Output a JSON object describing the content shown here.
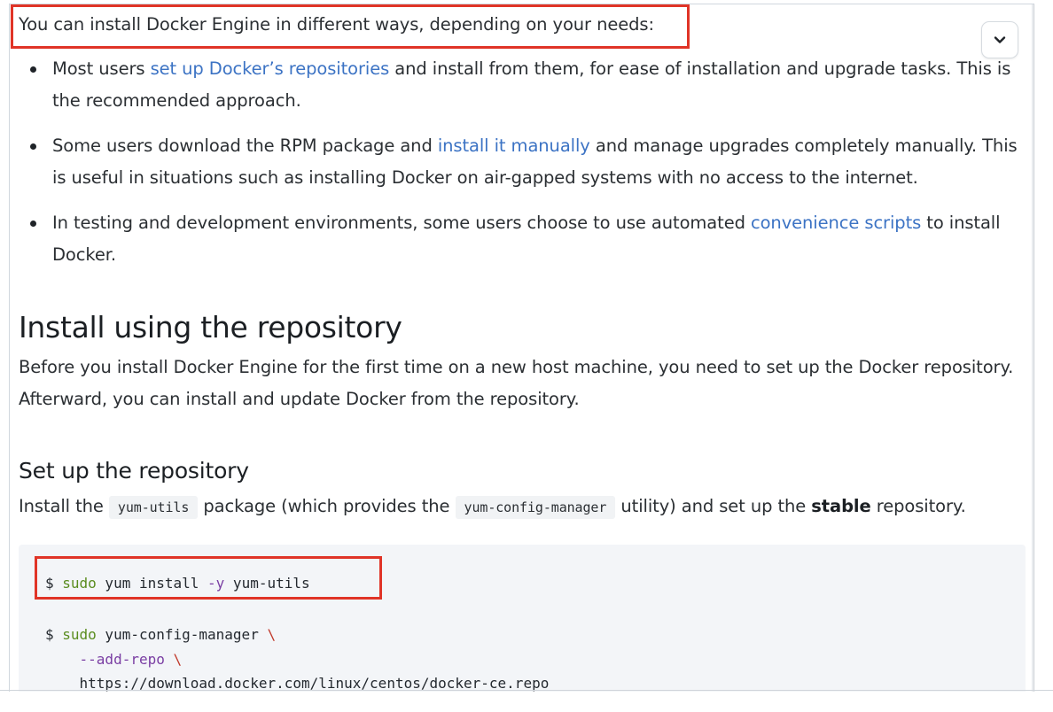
{
  "intro": {
    "text": "You can install Docker Engine in different ways, depending on your needs:"
  },
  "bullets": [
    {
      "before": "Most users ",
      "link": "set up Docker’s repositories",
      "after": " and install from them, for ease of installation and upgrade tasks. This is the recommended approach."
    },
    {
      "before": "Some users download the RPM package and ",
      "link": "install it manually",
      "after": " and manage upgrades completely manually. This is useful in situations such as installing Docker on air-gapped systems with no access to the internet."
    },
    {
      "before": "In testing and development environments, some users choose to use automated ",
      "link": "convenience scripts",
      "after": " to install Docker."
    }
  ],
  "section": {
    "title": "Install using the repository",
    "body": "Before you install Docker Engine for the first time on a new host machine, you need to set up the Docker repository. Afterward, you can install and update Docker from the repository."
  },
  "subsection": {
    "title": "Set up the repository",
    "p1": "Install the ",
    "code1": "yum-utils",
    "p2": " package (which provides the ",
    "code2": "yum-config-manager",
    "p3": " utility) and set up the ",
    "strong": "stable",
    "p4": " repository."
  },
  "code": {
    "line1": {
      "prompt": "$ ",
      "cmd": "sudo",
      "mid": " yum install ",
      "flag": "-y",
      "rest": " yum-utils"
    },
    "line2": {
      "prompt": "$ ",
      "cmd": "sudo",
      "rest": " yum-config-manager ",
      "cont": "\\"
    },
    "line3": {
      "flag": "    --add-repo",
      "cont": " \\"
    },
    "line4": {
      "text": "    https://download.docker.com/linux/centos/docker-ce.repo"
    }
  },
  "icons": {
    "collapse": "chevron-down-icon"
  },
  "colors": {
    "link": "#3c73c4",
    "highlight": "#e03427",
    "code_bg": "#f3f5f8"
  }
}
